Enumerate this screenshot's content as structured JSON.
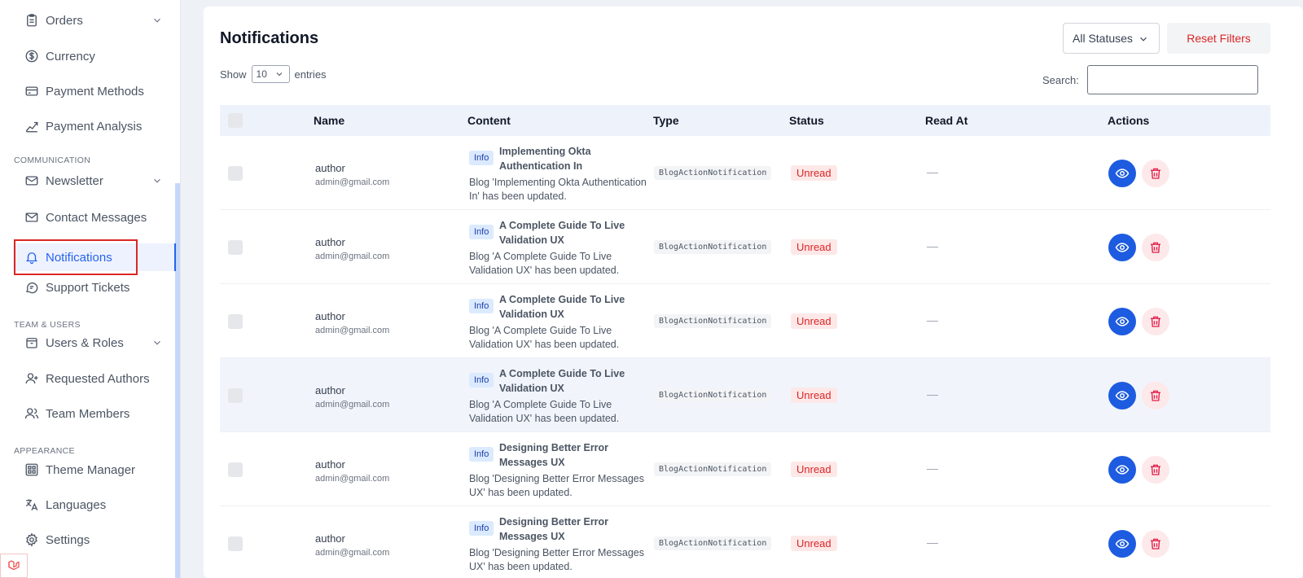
{
  "sidebar": {
    "items": [
      {
        "label": "Orders",
        "icon": "clipboard-icon"
      },
      {
        "label": "Currency",
        "icon": "currency-icon"
      },
      {
        "label": "Payment Methods",
        "icon": "credit-card-icon"
      },
      {
        "label": "Payment Analysis",
        "icon": "chart-line-icon"
      },
      {
        "label": "Newsletter",
        "icon": "mail-icon"
      },
      {
        "label": "Contact Messages",
        "icon": "envelope-icon"
      },
      {
        "label": "Notifications",
        "icon": "bell-icon"
      },
      {
        "label": "Support Tickets",
        "icon": "chat-icon"
      },
      {
        "label": "Users & Roles",
        "icon": "box-icon"
      },
      {
        "label": "Requested Authors",
        "icon": "user-plus-icon"
      },
      {
        "label": "Team Members",
        "icon": "users-icon"
      },
      {
        "label": "Theme Manager",
        "icon": "palette-icon"
      },
      {
        "label": "Languages",
        "icon": "translate-icon"
      },
      {
        "label": "Settings",
        "icon": "gear-icon"
      }
    ],
    "sections": {
      "communication": "COMMUNICATION",
      "team": "TEAM & USERS",
      "appearance": "APPEARANCE"
    }
  },
  "main": {
    "title": "Notifications",
    "status_filter": "All Statuses",
    "reset_label": "Reset Filters",
    "show_label": "Show",
    "entries_value": "10",
    "entries_label": "entries",
    "search_label": "Search:"
  },
  "table": {
    "headers": [
      "Name",
      "Content",
      "Type",
      "Status",
      "Read At",
      "Actions"
    ],
    "rows": [
      {
        "name": "author",
        "email": "admin@gmail.com",
        "badge": "Info",
        "title": "Implementing Okta Authentication In",
        "desc": "Blog 'Implementing Okta Authentication In' has been updated.",
        "type": "BlogActionNotification",
        "status": "Unread",
        "read_at": "—"
      },
      {
        "name": "author",
        "email": "admin@gmail.com",
        "badge": "Info",
        "title": "A Complete Guide To Live Validation UX",
        "desc": "Blog 'A Complete Guide To Live Validation UX' has been updated.",
        "type": "BlogActionNotification",
        "status": "Unread",
        "read_at": "—"
      },
      {
        "name": "author",
        "email": "admin@gmail.com",
        "badge": "Info",
        "title": "A Complete Guide To Live Validation UX",
        "desc": "Blog 'A Complete Guide To Live Validation UX' has been updated.",
        "type": "BlogActionNotification",
        "status": "Unread",
        "read_at": "—"
      },
      {
        "name": "author",
        "email": "admin@gmail.com",
        "badge": "Info",
        "title": "A Complete Guide To Live Validation UX",
        "desc": "Blog 'A Complete Guide To Live Validation UX' has been updated.",
        "type": "BlogActionNotification",
        "status": "Unread",
        "read_at": "—"
      },
      {
        "name": "author",
        "email": "admin@gmail.com",
        "badge": "Info",
        "title": "Designing Better Error Messages UX",
        "desc": "Blog 'Designing Better Error Messages UX' has been updated.",
        "type": "BlogActionNotification",
        "status": "Unread",
        "read_at": "—"
      },
      {
        "name": "author",
        "email": "admin@gmail.com",
        "badge": "Info",
        "title": "Designing Better Error Messages UX",
        "desc": "Blog 'Designing Better Error Messages UX' has been updated.",
        "type": "BlogActionNotification",
        "status": "Unread",
        "read_at": "—"
      }
    ]
  },
  "colors": {
    "accent": "#2563eb",
    "danger": "#dc2626",
    "view_button": "#1d5be0"
  }
}
